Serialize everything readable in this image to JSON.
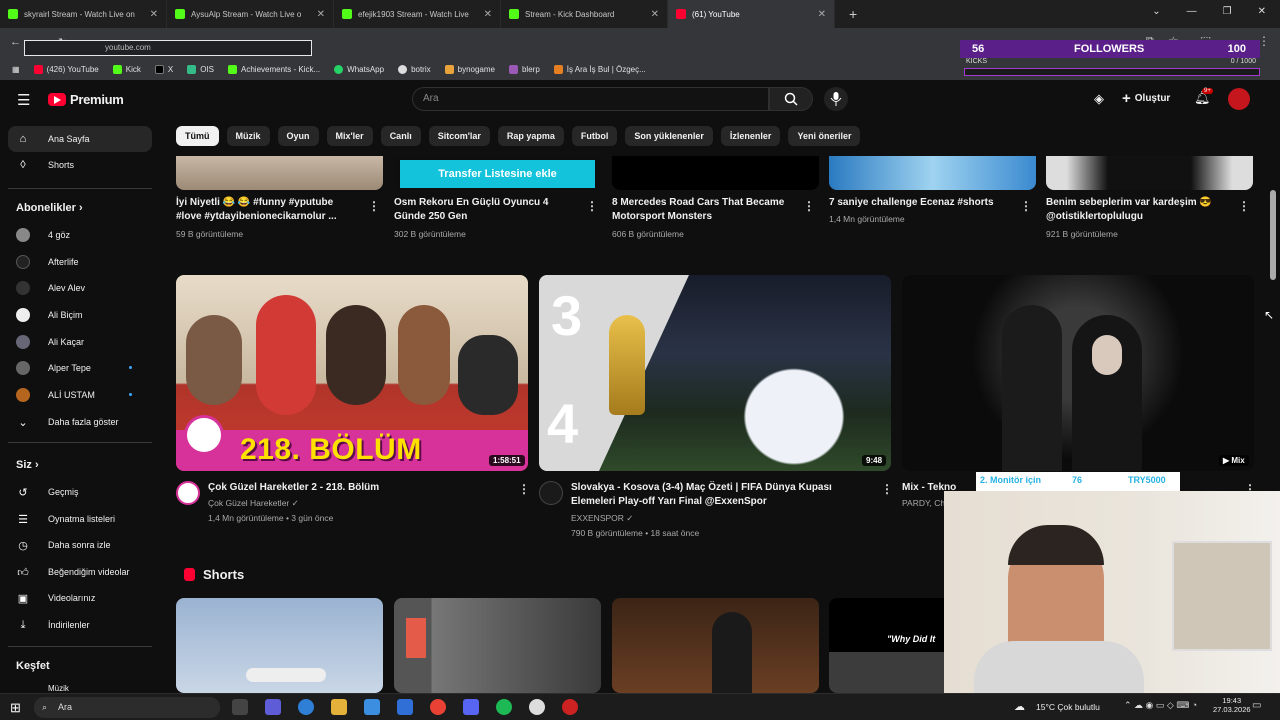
{
  "browser": {
    "tabs": [
      {
        "label": "skyrairl Stream - Watch Live on",
        "color": "#53fc18"
      },
      {
        "label": "AysuAlp Stream - Watch Live o",
        "color": "#53fc18"
      },
      {
        "label": "efejik1903 Stream - Watch Live",
        "color": "#53fc18"
      },
      {
        "label": "Stream - Kick Dashboard",
        "color": "#53fc18"
      },
      {
        "label": "(61) YouTube",
        "color": "#ff0033"
      }
    ],
    "address": "youtube.com",
    "bookmarks": [
      "(426) YouTube",
      "Kick",
      "X",
      "OIS",
      "Achievements - Kick...",
      "WhatsApp",
      "botrix",
      "bynogame",
      "blerp",
      "İş Ara İş Bul | Özgeç..."
    ]
  },
  "overlay": {
    "followers_count": "56",
    "followers_label": "FOLLOWERS",
    "followers_goal": "100",
    "kicks_label": "KICKS",
    "kicks_progress": "0 / 1000",
    "kicks_progress_fraction": 0
  },
  "youtube": {
    "logo": "Premium",
    "search_placeholder": "Ara",
    "create_label": "Oluştur",
    "notif_badge": "9+",
    "chips": [
      "Tümü",
      "Müzik",
      "Oyun",
      "Mix'ler",
      "Canlı",
      "Sitcom'lar",
      "Rap yapma",
      "Futbol",
      "Son yüklenenler",
      "İzlenenler",
      "Yeni öneriler"
    ]
  },
  "sidebar": {
    "main": [
      {
        "label": "Ana Sayfa"
      },
      {
        "label": "Shorts"
      }
    ],
    "subs_heading": "Abonelikler",
    "subs": [
      {
        "label": "4 göz"
      },
      {
        "label": "Afterlife"
      },
      {
        "label": "Alev Alev"
      },
      {
        "label": "Ali Biçim"
      },
      {
        "label": "Ali Kaçar"
      },
      {
        "label": "Alper Tepe"
      },
      {
        "label": "ALİ USTAM"
      }
    ],
    "show_more": "Daha fazla göster",
    "you_heading": "Siz",
    "you": [
      {
        "label": "Geçmiş"
      },
      {
        "label": "Oynatma listeleri"
      },
      {
        "label": "Daha sonra izle"
      },
      {
        "label": "Beğendiğim videolar"
      },
      {
        "label": "Videolarınız"
      },
      {
        "label": "İndirilenler"
      }
    ],
    "explore_heading": "Keşfet",
    "explore_item": "Müzik"
  },
  "top_row": [
    {
      "title1": "İyi Niyetli 😂 😂 #funny #yputube",
      "title2": "#love #ytdayibenionecikarnolur ...",
      "meta": "59 B görüntüleme"
    },
    {
      "title1": "Osm Rekoru En Güçlü Oyuncu 4",
      "title2": "Günde 250 Gen",
      "meta": "302 B görüntüleme",
      "banner": "Transfer Listesine ekle"
    },
    {
      "title1": "8 Mercedes Road Cars That Became",
      "title2": "Motorsport Monsters",
      "meta": "606 B görüntüleme"
    },
    {
      "title1": "7 saniye challenge Ecenaz #shorts",
      "title2": "",
      "meta": "1,4 Mn görüntüleme"
    },
    {
      "title1": "Benim sebeplerim var kardeşim 😎",
      "title2": "@otistiklertoplulugu",
      "meta": "921 B görüntüleme"
    }
  ],
  "videos": [
    {
      "title": "Çok Güzel Hareketler 2 - 218. Bölüm",
      "channel": "Çok Güzel Hareketler",
      "meta": "1,4 Mn görüntüleme • 3 gün önce",
      "duration": "1:58:51",
      "thumb_text": "218. BÖLÜM"
    },
    {
      "title1": "Slovakya - Kosova (3-4) Maç Özeti | FIFA Dünya Kupası",
      "title2": "Elemeleri Play-off Yarı Final @ExxenSpor",
      "channel": "EXXENSPOR",
      "meta": "790 B görüntüleme • 18 saat önce",
      "duration": "9:48",
      "score_top": "3",
      "score_bottom": "4"
    },
    {
      "title": "Mix - Tekno",
      "channel": "PARDY, Ch",
      "badge": "Mix"
    }
  ],
  "shorts_heading": "Shorts",
  "shorts_caption": "\"Why Did It",
  "webcam_overlay": {
    "text1": "2. Monitör için",
    "text2": "76",
    "text3": "TRY5000"
  },
  "taskbar": {
    "search": "Ara",
    "weather": "15°C  Çok bulutlu",
    "time": "19:43",
    "date": "27.03.2026"
  }
}
